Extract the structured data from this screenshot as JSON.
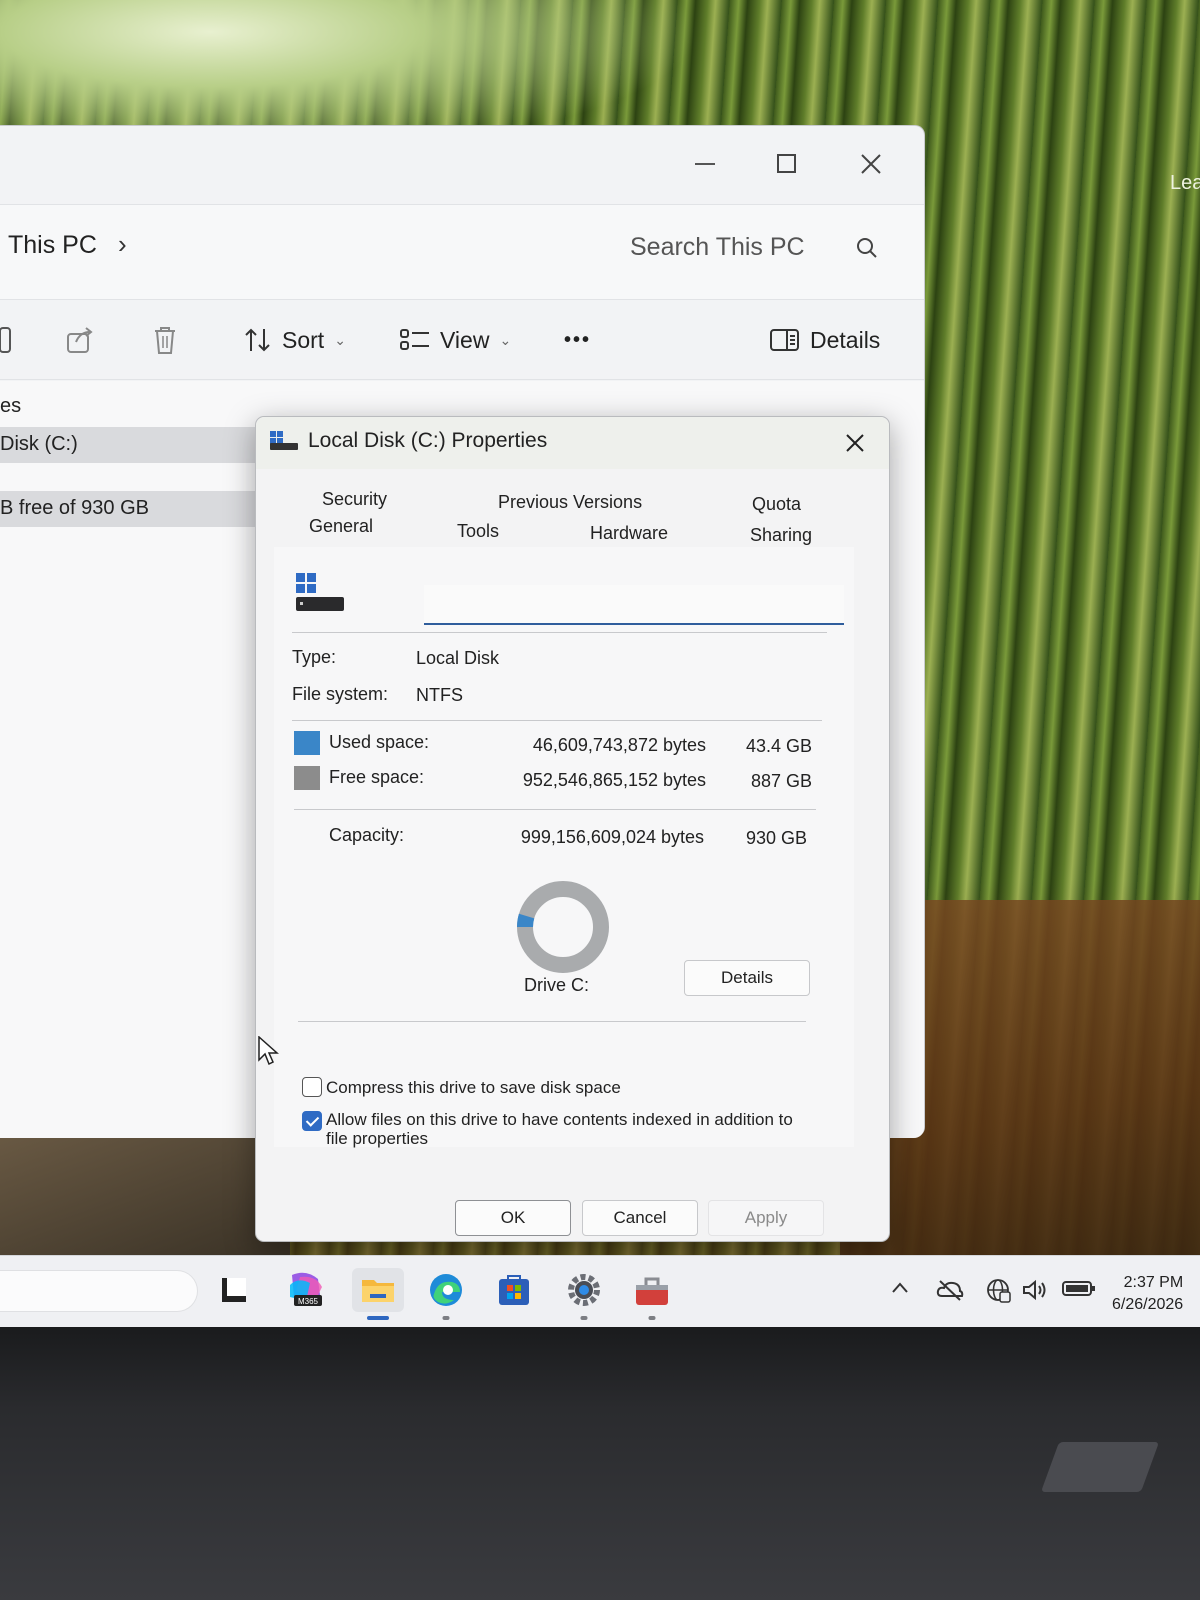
{
  "desktop": {
    "wallpaper_text": "Lea"
  },
  "explorer": {
    "breadcrumb": "This PC",
    "breadcrumb_chevron": "›",
    "search_placeholder": "Search This PC",
    "commands": {
      "sort_label": "Sort",
      "view_label": "View",
      "more_label": "•••",
      "details_label": "Details"
    },
    "sidebar": {
      "section_label": "es",
      "drive_label": "Disk (C:)",
      "drive_free": "B free of 930 GB"
    }
  },
  "dialog": {
    "title": "Local Disk (C:) Properties",
    "tabs": {
      "security": "Security",
      "previous_versions": "Previous Versions",
      "quota": "Quota",
      "general": "General",
      "tools": "Tools",
      "hardware": "Hardware",
      "sharing": "Sharing"
    },
    "drive_name_value": "",
    "type_label": "Type:",
    "type_value": "Local Disk",
    "fs_label": "File system:",
    "fs_value": "NTFS",
    "used": {
      "label": "Used space:",
      "bytes": "46,609,743,872 bytes",
      "size": "43.4 GB",
      "color": "#3a86c8"
    },
    "free": {
      "label": "Free space:",
      "bytes": "952,546,865,152 bytes",
      "size": "887 GB",
      "color": "#8c8c8c"
    },
    "capacity": {
      "label": "Capacity:",
      "bytes": "999,156,609,024 bytes",
      "size": "930 GB"
    },
    "used_fraction": 0.0466,
    "drive_caption": "Drive C:",
    "details_button": "Details",
    "compress_label": "Compress this drive to save disk space",
    "compress_checked": false,
    "index_label": "Allow files on this drive to have contents indexed in addition to file properties",
    "index_checked": true,
    "ok_button": "OK",
    "cancel_button": "Cancel",
    "apply_button": "Apply"
  },
  "taskbar": {
    "apps": [
      "terminal-icon",
      "m365-icon",
      "file-explorer-icon",
      "edge-icon",
      "store-icon",
      "settings-icon",
      "toolbox-icon"
    ],
    "m365_badge": "M365",
    "tray": [
      "chevron-up-icon",
      "cloud-off-icon",
      "network-icon",
      "volume-icon",
      "battery-icon"
    ],
    "time": "2:37 PM",
    "date": "6/26/2026"
  }
}
